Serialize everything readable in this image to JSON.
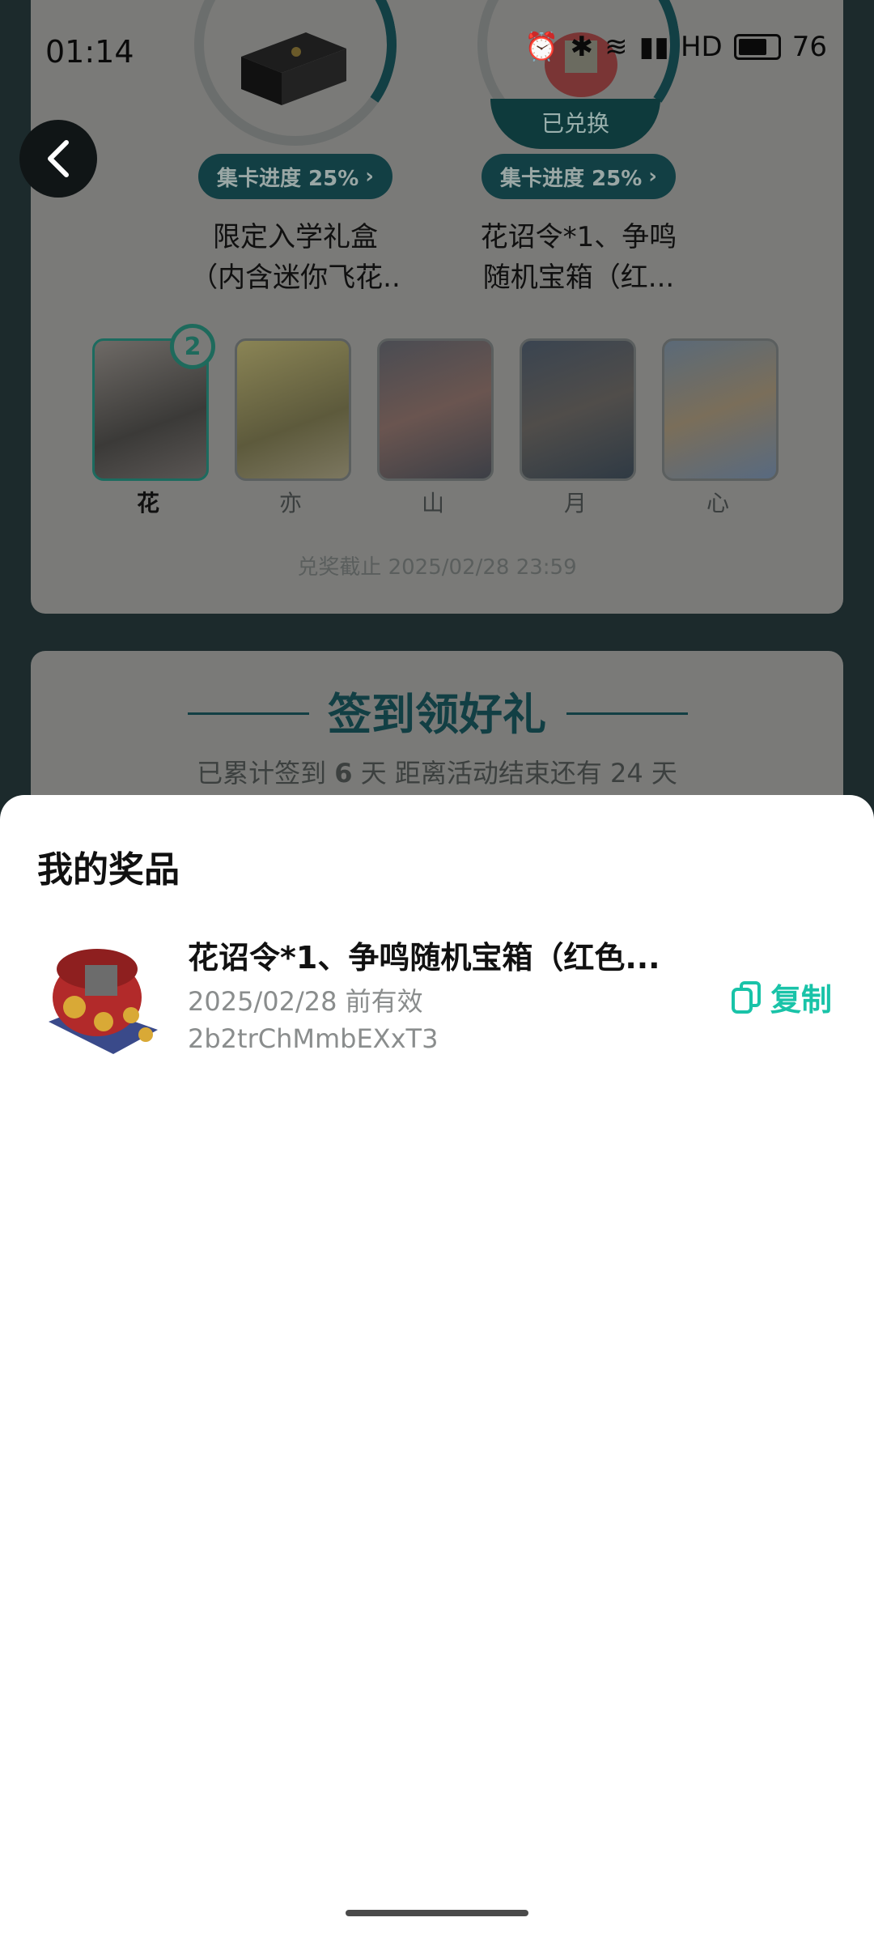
{
  "status_bar": {
    "time": "01:14",
    "battery": "76",
    "hd": "HD"
  },
  "prizes": [
    {
      "progress_label": "集卡进度 25%",
      "name_line1": "限定入学礼盒",
      "name_line2": "（内含迷你飞花..",
      "exchanged": ""
    },
    {
      "progress_label": "集卡进度 25%",
      "name_line1": "花诏令*1、争鸣",
      "name_line2": "随机宝箱（红...",
      "exchanged": "已兑换"
    }
  ],
  "cards": [
    {
      "label": "花",
      "count": "2"
    },
    {
      "label": "亦"
    },
    {
      "label": "山"
    },
    {
      "label": "月"
    },
    {
      "label": "心"
    }
  ],
  "deadline": "兑奖截止 2025/02/28 23:59",
  "checkin": {
    "title": "签到领好礼",
    "sub_prefix": "已累计签到",
    "days": "6",
    "sub_suffix": "天  距离活动结束还有 24 天"
  },
  "sheet": {
    "title": "我的奖品",
    "item": {
      "title": "花诏令*1、争鸣随机宝箱（红色...",
      "valid_until": "2025/02/28 前有效",
      "code": "2b2trChMmbEXxT3",
      "copy_label": "复制"
    }
  },
  "colors": {
    "accent": "#19c3a8",
    "dark_teal": "#123f44"
  }
}
